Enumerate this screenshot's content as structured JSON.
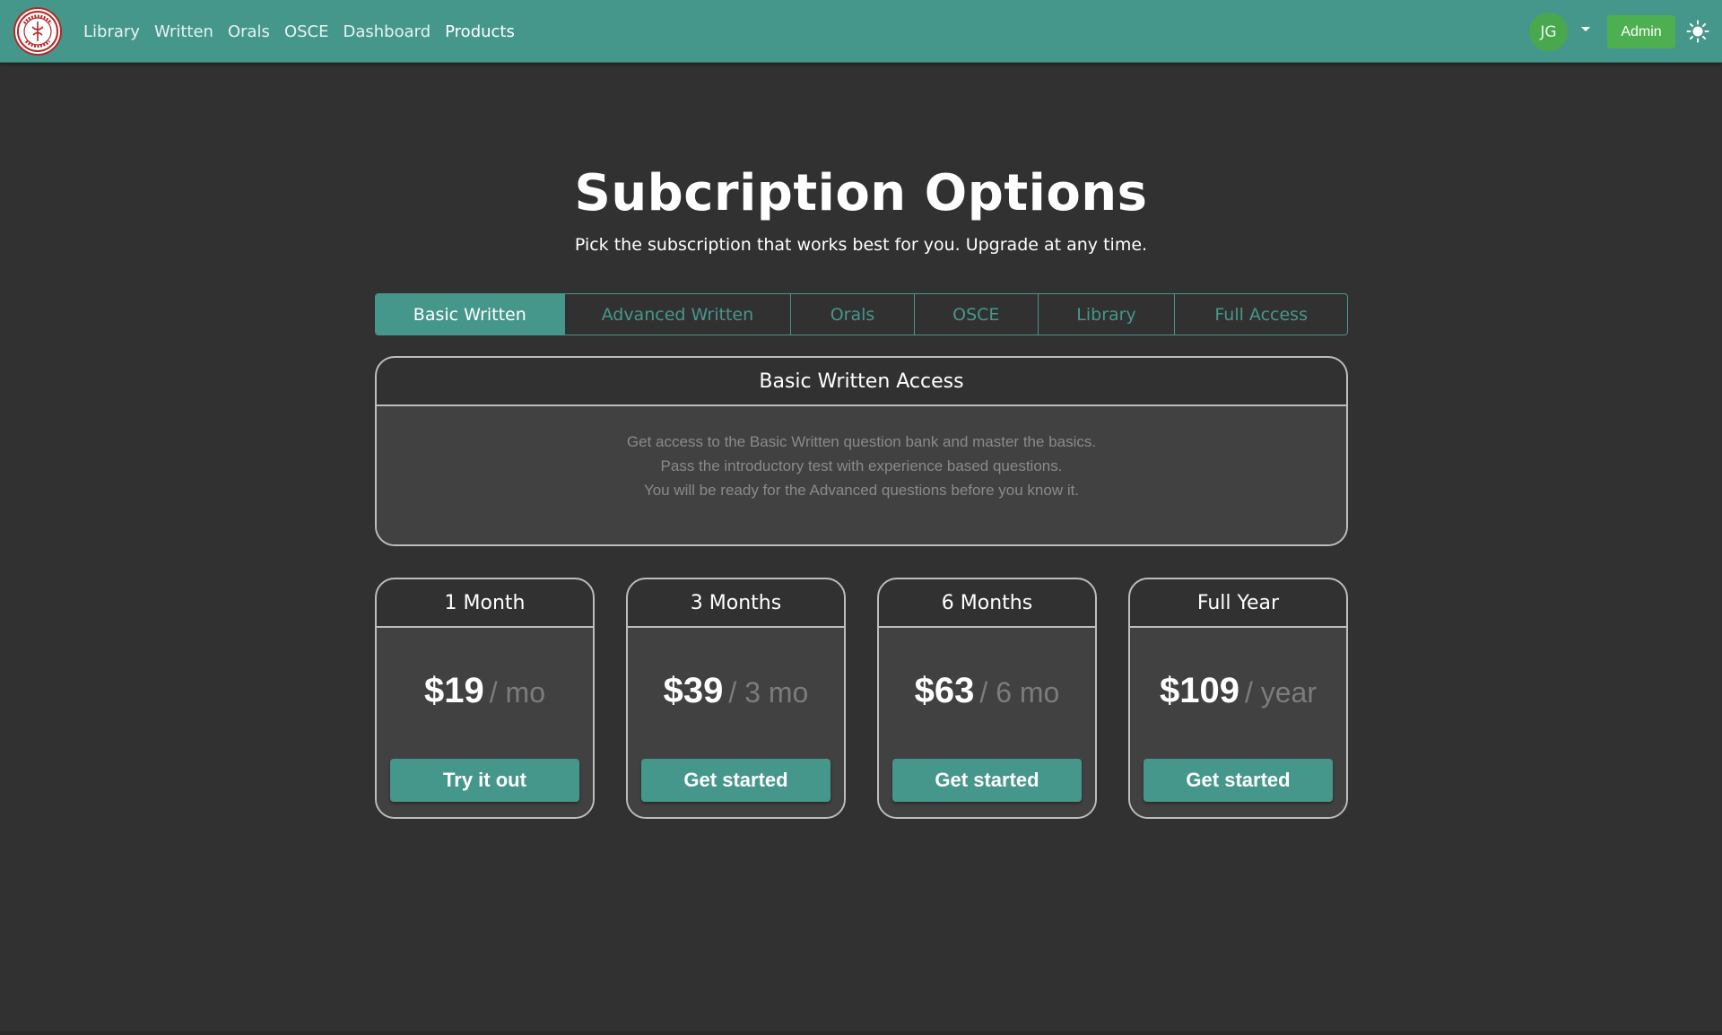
{
  "nav": {
    "links": [
      "Library",
      "Written",
      "Orals",
      "OSCE",
      "Dashboard",
      "Products"
    ],
    "active": "Products",
    "avatar_initials": "JG",
    "admin_label": "Admin",
    "logo_icon": "university-seal-logo",
    "theme_icon": "sun-icon"
  },
  "hero": {
    "title": "Subcription Options",
    "subtitle": "Pick the subscription that works best for you. Upgrade at any time."
  },
  "tabs": {
    "items": [
      "Basic Written",
      "Advanced Written",
      "Orals",
      "OSCE",
      "Library",
      "Full Access"
    ],
    "active": "Basic Written"
  },
  "access": {
    "title": "Basic Written Access",
    "lines": [
      "Get access to the Basic Written question bank and master the basics.",
      "Pass the introductory test with experience based questions.",
      "You will be ready for the Advanced questions before you know it."
    ]
  },
  "plans": [
    {
      "title": "1 Month",
      "price": "$19",
      "period": "/ mo",
      "button": "Try it out"
    },
    {
      "title": "3 Months",
      "price": "$39",
      "period": "/ 3 mo",
      "button": "Get started"
    },
    {
      "title": "6 Months",
      "price": "$63",
      "period": "/ 6 mo",
      "button": "Get started"
    },
    {
      "title": "Full Year",
      "price": "$109",
      "period": "/ year",
      "button": "Get started"
    }
  ],
  "colors": {
    "brand": "#46978b",
    "background": "#313131",
    "card_body": "#414141",
    "admin_green": "#4caf50"
  }
}
